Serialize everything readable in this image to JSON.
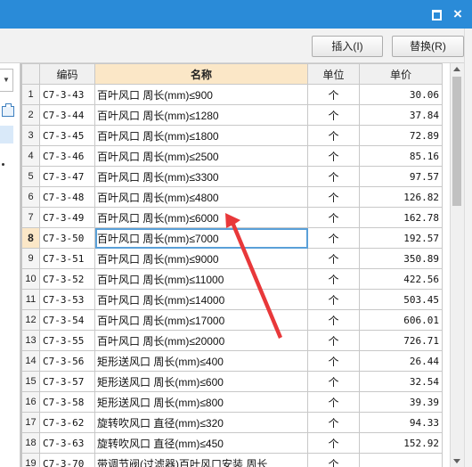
{
  "window": {
    "maximize_icon": "maximize-icon",
    "close_icon": "close-icon",
    "close_glyph": "×"
  },
  "toolbar": {
    "insert_label": "插入(I)",
    "replace_label": "替换(R)"
  },
  "left_panel": {
    "dropdown_glyph": "▼"
  },
  "table": {
    "columns": [
      "",
      "编码",
      "名称",
      "单位",
      "单价"
    ],
    "selected_row": 8,
    "rows": [
      {
        "n": "1",
        "code": "C7-3-43",
        "name": "百叶风口 周长(mm)≤900",
        "unit": "个",
        "price": "30.06"
      },
      {
        "n": "2",
        "code": "C7-3-44",
        "name": "百叶风口 周长(mm)≤1280",
        "unit": "个",
        "price": "37.84"
      },
      {
        "n": "3",
        "code": "C7-3-45",
        "name": "百叶风口 周长(mm)≤1800",
        "unit": "个",
        "price": "72.89"
      },
      {
        "n": "4",
        "code": "C7-3-46",
        "name": "百叶风口 周长(mm)≤2500",
        "unit": "个",
        "price": "85.16"
      },
      {
        "n": "5",
        "code": "C7-3-47",
        "name": "百叶风口 周长(mm)≤3300",
        "unit": "个",
        "price": "97.57"
      },
      {
        "n": "6",
        "code": "C7-3-48",
        "name": "百叶风口 周长(mm)≤4800",
        "unit": "个",
        "price": "126.82"
      },
      {
        "n": "7",
        "code": "C7-3-49",
        "name": "百叶风口 周长(mm)≤6000",
        "unit": "个",
        "price": "162.78"
      },
      {
        "n": "8",
        "code": "C7-3-50",
        "name": "百叶风口 周长(mm)≤7000",
        "unit": "个",
        "price": "192.57"
      },
      {
        "n": "9",
        "code": "C7-3-51",
        "name": "百叶风口 周长(mm)≤9000",
        "unit": "个",
        "price": "350.89"
      },
      {
        "n": "10",
        "code": "C7-3-52",
        "name": "百叶风口 周长(mm)≤11000",
        "unit": "个",
        "price": "422.56"
      },
      {
        "n": "11",
        "code": "C7-3-53",
        "name": "百叶风口 周长(mm)≤14000",
        "unit": "个",
        "price": "503.45"
      },
      {
        "n": "12",
        "code": "C7-3-54",
        "name": "百叶风口 周长(mm)≤17000",
        "unit": "个",
        "price": "606.01"
      },
      {
        "n": "13",
        "code": "C7-3-55",
        "name": "百叶风口 周长(mm)≤20000",
        "unit": "个",
        "price": "726.71"
      },
      {
        "n": "14",
        "code": "C7-3-56",
        "name": "矩形送风口 周长(mm)≤400",
        "unit": "个",
        "price": "26.44"
      },
      {
        "n": "15",
        "code": "C7-3-57",
        "name": "矩形送风口 周长(mm)≤600",
        "unit": "个",
        "price": "32.54"
      },
      {
        "n": "16",
        "code": "C7-3-58",
        "name": "矩形送风口 周长(mm)≤800",
        "unit": "个",
        "price": "39.39"
      },
      {
        "n": "17",
        "code": "C7-3-62",
        "name": "旋转吹风口 直径(mm)≤320",
        "unit": "个",
        "price": "94.33"
      },
      {
        "n": "18",
        "code": "C7-3-63",
        "name": "旋转吹风口 直径(mm)≤450",
        "unit": "个",
        "price": "152.92"
      },
      {
        "n": "19",
        "code": "C7-3-70",
        "name": "带调节阀(过滤器)百叶风口安装 周长",
        "unit": "个",
        "price": ""
      }
    ]
  },
  "colors": {
    "titlebar": "#2a8bd8",
    "header_highlight": "#fbe7c7",
    "selection_border": "#5aa0d8",
    "arrow": "#e8383a"
  }
}
